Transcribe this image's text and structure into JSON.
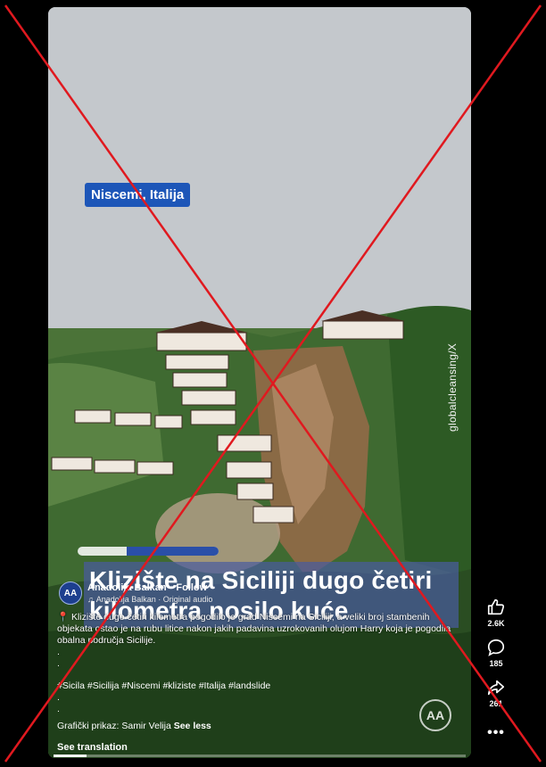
{
  "video": {
    "location_tag": "Niscemi, Italija",
    "watermark": "globalcleansing/X",
    "headline": "Klizište na Siciliji dugo četiri kilometra nosilo kuće",
    "progress_fraction": 0.65,
    "seek_fraction": 0.08
  },
  "post": {
    "avatar_text": "AA",
    "account_name": "Anadolija Balkan",
    "follow_label": "· Follow",
    "audio_label": "Anadolija Balkan · Original audio",
    "caption": "Klizište dugo četiri kilometra pogodilo je grad Niscemi na Siciliji, a veliki broj stambenih objekata ostao je na rubu litice nakon jakih padavina uzrokovanih olujom Harry koja je pogodila obalna područja Sicilije.",
    "hashtags": "#Sicila #Sicilija #Niscemi #kliziste #Italija #landslide",
    "credit": "Grafički prikaz: Samir Velija",
    "see_less": "See less",
    "see_translation": "See translation",
    "logo_text": "AA"
  },
  "actions": {
    "like_count": "2.6K",
    "comment_count": "185",
    "share_count": "261"
  },
  "colors": {
    "tag_blue": "#1d56b8",
    "headline_overlay": "#4a5c9e",
    "cross_red": "#e0191f"
  },
  "icons": [
    "like-icon",
    "comment-icon",
    "share-icon",
    "more-icon",
    "music-note-icon",
    "pin-icon"
  ]
}
